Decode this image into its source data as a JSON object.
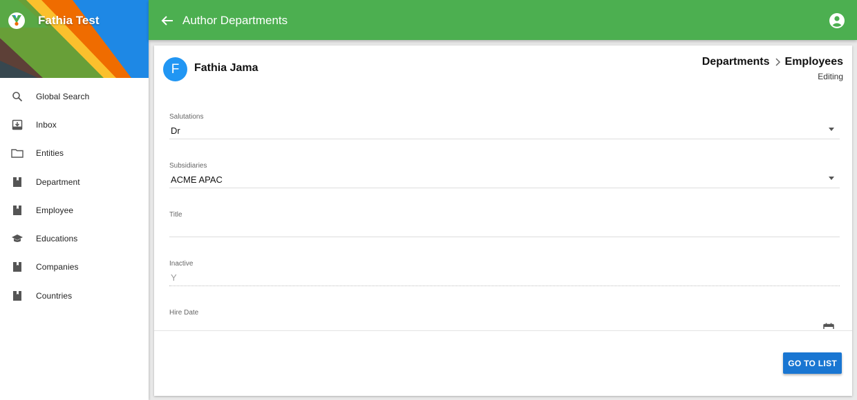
{
  "sidebar": {
    "brand_title": "Fathia Test",
    "items": [
      {
        "label": "Global Search",
        "icon": "search-icon"
      },
      {
        "label": "Inbox",
        "icon": "inbox-icon"
      },
      {
        "label": "Entities",
        "icon": "folder-icon"
      },
      {
        "label": "Department",
        "icon": "bookmark-icon"
      },
      {
        "label": "Employee",
        "icon": "bookmark-icon"
      },
      {
        "label": "Educations",
        "icon": "school-icon"
      },
      {
        "label": "Companies",
        "icon": "bookmark-icon"
      },
      {
        "label": "Countries",
        "icon": "bookmark-icon"
      }
    ]
  },
  "appbar": {
    "title": "Author Departments",
    "color": "#4caf50"
  },
  "record": {
    "avatar_letter": "F",
    "name": "Fathia Jama",
    "breadcrumb": [
      "Departments",
      "Employees"
    ],
    "mode": "Editing"
  },
  "form": {
    "fields": [
      {
        "label": "Salutations",
        "value": "Dr"
      },
      {
        "label": "Subsidiaries",
        "value": "ACME APAC"
      },
      {
        "label": "Title",
        "value": ""
      },
      {
        "label": "Inactive",
        "value": "Y"
      },
      {
        "label": "Hire Date",
        "value": ""
      }
    ]
  },
  "actions": {
    "go_to_list": "GO TO LIST",
    "accent": "#1976d2"
  }
}
